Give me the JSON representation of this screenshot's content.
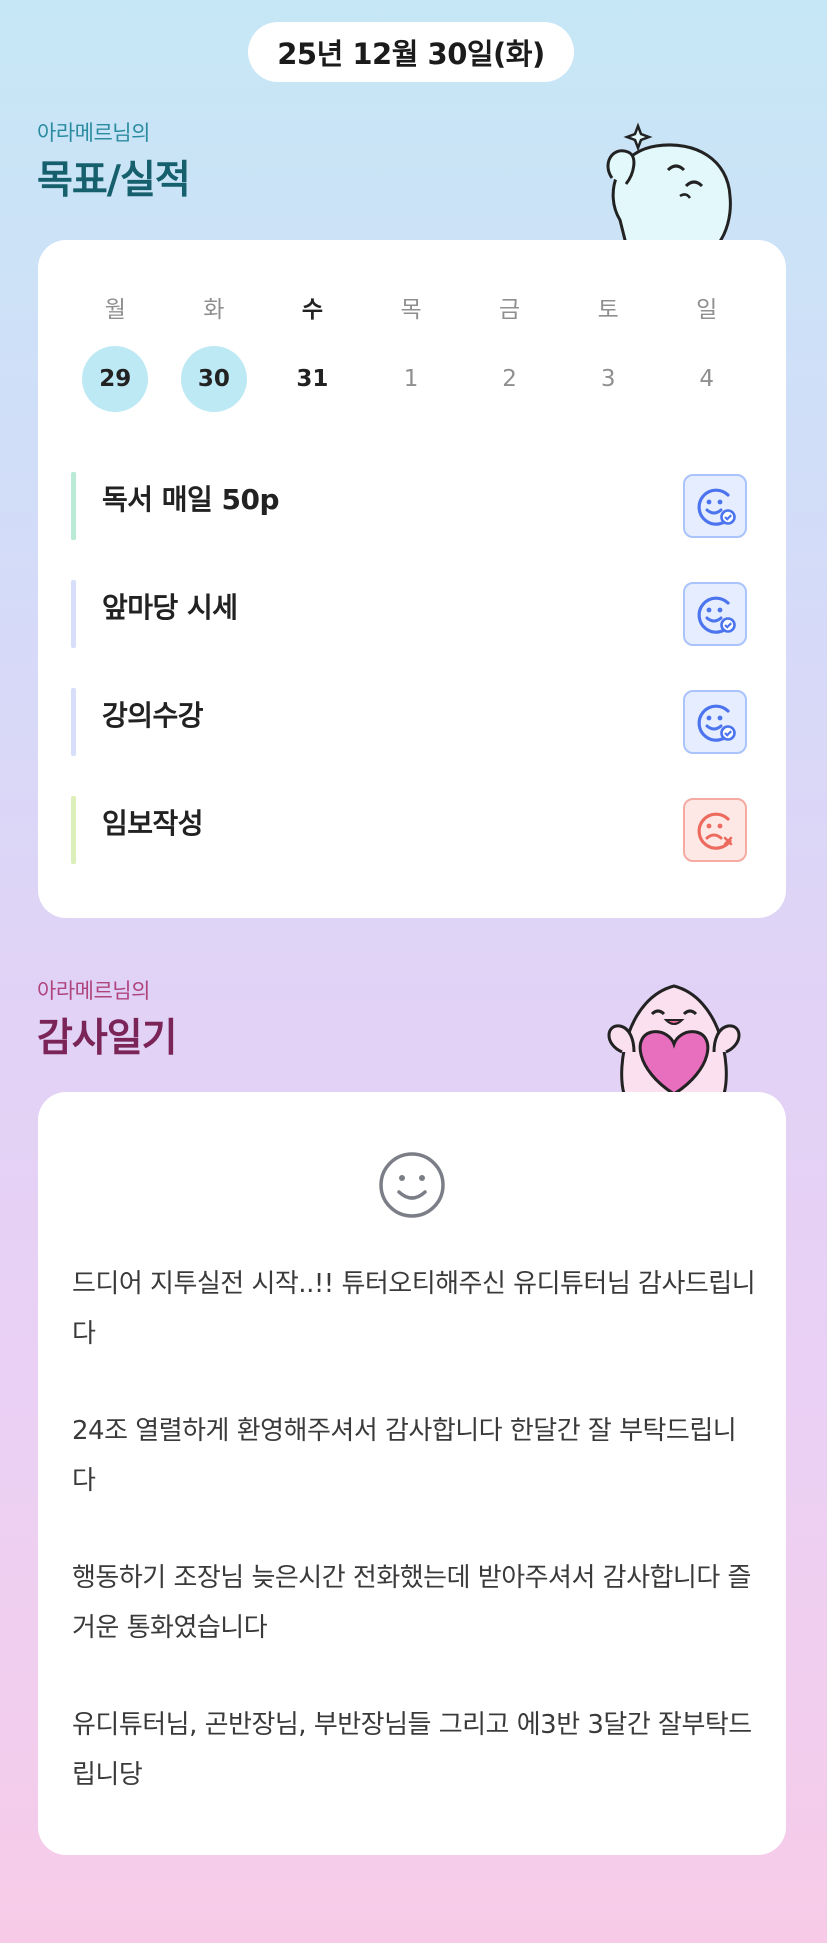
{
  "header": {
    "date": "25년 12월 30일(화)"
  },
  "goals_section": {
    "owner_line": "아라메르님의",
    "title": "목표/실적"
  },
  "week": [
    {
      "label": "월",
      "num": "29",
      "state": "done"
    },
    {
      "label": "화",
      "num": "30",
      "state": "done"
    },
    {
      "label": "수",
      "num": "31",
      "state": "today"
    },
    {
      "label": "목",
      "num": "1",
      "state": "future"
    },
    {
      "label": "금",
      "num": "2",
      "state": "future"
    },
    {
      "label": "토",
      "num": "3",
      "state": "future"
    },
    {
      "label": "일",
      "num": "4",
      "state": "future"
    }
  ],
  "goals": [
    {
      "name": "독서 매일 50p",
      "bar_color": "#b9ead6",
      "status": "achieved",
      "status_icon": "smile-check-icon"
    },
    {
      "name": "앞마당 시세",
      "bar_color": "#d6defa",
      "status": "achieved",
      "status_icon": "smile-check-icon"
    },
    {
      "name": "강의수강",
      "bar_color": "#d6defa",
      "status": "achieved",
      "status_icon": "smile-check-icon"
    },
    {
      "name": "임보작성",
      "bar_color": "#dcefb8",
      "status": "missed",
      "status_icon": "sad-x-icon"
    }
  ],
  "thanks_section": {
    "owner_line": "아라메르님의",
    "title": "감사일기"
  },
  "thanks_entries": [
    "드디어 지투실전 시작..!! 튜터오티해주신 유디튜터님 감사드립니다",
    "24조 열렬하게 환영해주셔서 감사합니다 한달간 잘 부탁드립니다",
    "행동하기 조장님 늦은시간 전화했는데 받아주셔서 감사합니다 즐거운 통화였습니다",
    "유디튜터님, 곤반장님, 부반장님들 그리고 에3반 3달간 잘부탁드립니당"
  ],
  "colors": {
    "done_circle": "#bde9f4",
    "goal_title": "#16606e",
    "thanks_title": "#7a2458",
    "ok_icon": "#4b74ee",
    "fail_icon": "#ec6a5e"
  }
}
